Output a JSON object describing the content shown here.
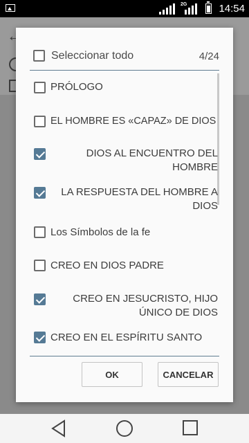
{
  "status_bar": {
    "time": "14:54",
    "network": "2G"
  },
  "dialog": {
    "select_all_label": "Seleccionar todo",
    "count": "4/24",
    "items": [
      {
        "label": "PRÓLOGO",
        "checked": false
      },
      {
        "label": "EL HOMBRE ES «CAPAZ» DE DIOS",
        "checked": false
      },
      {
        "label": "DIOS AL ENCUENTRO DEL HOMBRE",
        "checked": true
      },
      {
        "label": "LA RESPUESTA DEL HOMBRE A DIOS",
        "checked": true
      },
      {
        "label": "Los Símbolos de la fe",
        "checked": false
      },
      {
        "label": "CREO EN DIOS PADRE",
        "checked": false
      },
      {
        "label": "CREO EN JESUCRISTO, HIJO ÚNICO DE DIOS",
        "checked": true
      },
      {
        "label": "CREO EN EL ESPÍRITU SANTO",
        "checked": true
      }
    ],
    "ok_label": "OK",
    "cancel_label": "CANCELAR"
  },
  "icons": {
    "gallery": "gallery-icon",
    "signal": "signal-icon",
    "battery": "battery-icon",
    "back": "nav-back-icon",
    "home": "nav-home-icon",
    "recent": "nav-recent-icon"
  },
  "colors": {
    "checkbox_checked": "#557a95",
    "divider": "#5f7c90"
  }
}
